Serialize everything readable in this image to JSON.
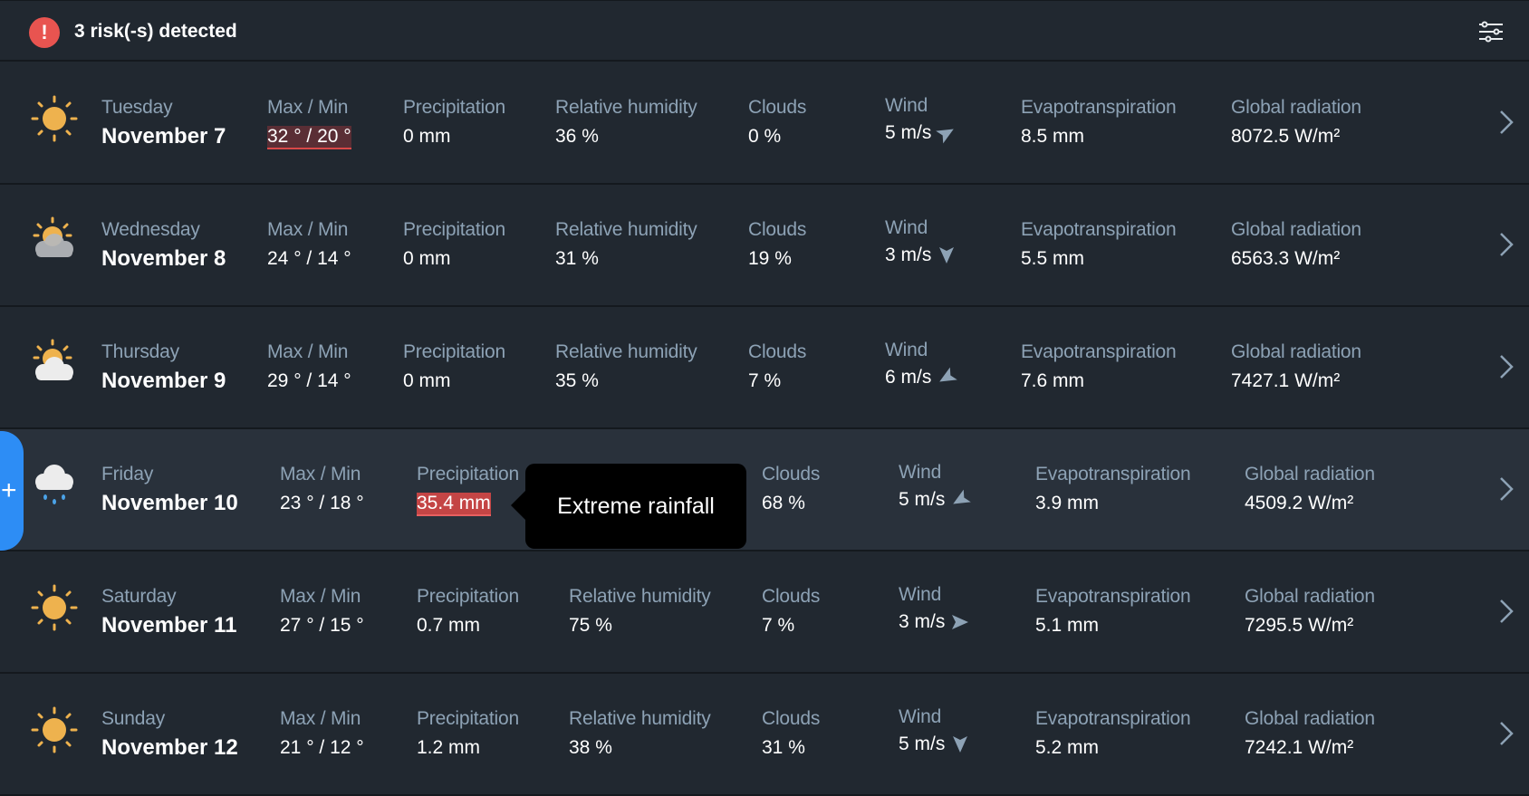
{
  "header": {
    "risk_icon": "exclamation-icon",
    "risk_text": "3 risk(-s) detected",
    "filter_icon": "sliders-icon"
  },
  "labels": {
    "max_min": "Max / Min",
    "precipitation": "Precipitation",
    "humidity": "Relative humidity",
    "clouds": "Clouds",
    "wind": "Wind",
    "evapotranspiration": "Evapotranspiration",
    "radiation": "Global radiation"
  },
  "colors": {
    "background": "#212830",
    "active_row": "#29313b",
    "accent": "#2d8df5",
    "risk": "#e85450",
    "label": "#8da2b5",
    "sun": "#eeb24e"
  },
  "tooltip": {
    "text": "Extreme rainfall"
  },
  "add_button": {
    "label": "+"
  },
  "days": [
    {
      "weekday": "Tuesday",
      "date": "November 7",
      "icon": "sun-icon",
      "max_min": "32 ° / 20 °",
      "precipitation": "0 mm",
      "humidity": "36 %",
      "clouds": "0 %",
      "wind": "5 m/s",
      "wind_dir_deg": 60,
      "evapotranspiration": "8.5 mm",
      "radiation": "8072.5 W/m²",
      "risk": "temperature"
    },
    {
      "weekday": "Wednesday",
      "date": "November 8",
      "icon": "sun-behind-grey-cloud-icon",
      "max_min": "24 ° / 14 °",
      "precipitation": "0 mm",
      "humidity": "31 %",
      "clouds": "19 %",
      "wind": "3 m/s",
      "wind_dir_deg": 180,
      "evapotranspiration": "5.5 mm",
      "radiation": "6563.3 W/m²",
      "risk": ""
    },
    {
      "weekday": "Thursday",
      "date": "November 9",
      "icon": "sun-behind-cloud-icon",
      "max_min": "29 ° / 14 °",
      "precipitation": "0 mm",
      "humidity": "35 %",
      "clouds": "7 %",
      "wind": "6 m/s",
      "wind_dir_deg": 240,
      "evapotranspiration": "7.6 mm",
      "radiation": "7427.1 W/m²",
      "risk": ""
    },
    {
      "weekday": "Friday",
      "date": "November 10",
      "icon": "rain-cloud-icon",
      "max_min": "23 ° / 18 °",
      "precipitation": "35.4 mm",
      "humidity": "",
      "clouds": "68 %",
      "wind": "5 m/s",
      "wind_dir_deg": 240,
      "evapotranspiration": "3.9 mm",
      "radiation": "4509.2 W/m²",
      "risk": "precipitation"
    },
    {
      "weekday": "Saturday",
      "date": "November 11",
      "icon": "sun-icon",
      "max_min": "27 ° / 15 °",
      "precipitation": "0.7 mm",
      "humidity": "75 %",
      "clouds": "7 %",
      "wind": "3 m/s",
      "wind_dir_deg": 90,
      "evapotranspiration": "5.1 mm",
      "radiation": "7295.5 W/m²",
      "risk": ""
    },
    {
      "weekday": "Sunday",
      "date": "November 12",
      "icon": "sun-icon",
      "max_min": "21 ° / 12 °",
      "precipitation": "1.2 mm",
      "humidity": "38 %",
      "clouds": "31 %",
      "wind": "5 m/s",
      "wind_dir_deg": 180,
      "evapotranspiration": "5.2 mm",
      "radiation": "7242.1 W/m²",
      "risk": ""
    }
  ]
}
